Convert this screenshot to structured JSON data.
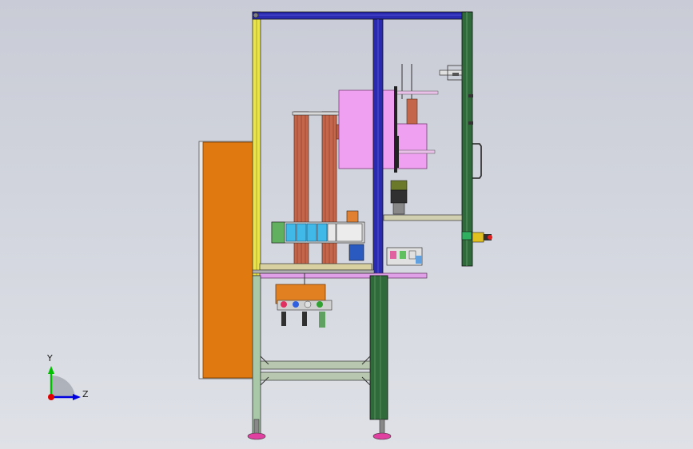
{
  "view": {
    "background_top": "#c9ccd6",
    "background_bottom": "#dfe1e7"
  },
  "triad": {
    "y_label": "Y",
    "z_label": "Z",
    "y_color": "#00c000",
    "z_color": "#0000e0",
    "origin_color": "#e00000"
  },
  "colors": {
    "frame_yellow": "#e8e44a",
    "frame_blue": "#2a2ab0",
    "frame_green": "#2f6b3a",
    "frame_gray": "#a8b0a8",
    "panel_orange": "#e07a10",
    "pink": "#f0a0f0",
    "copper": "#c4664a",
    "cyan_valve": "#40b8e8"
  }
}
